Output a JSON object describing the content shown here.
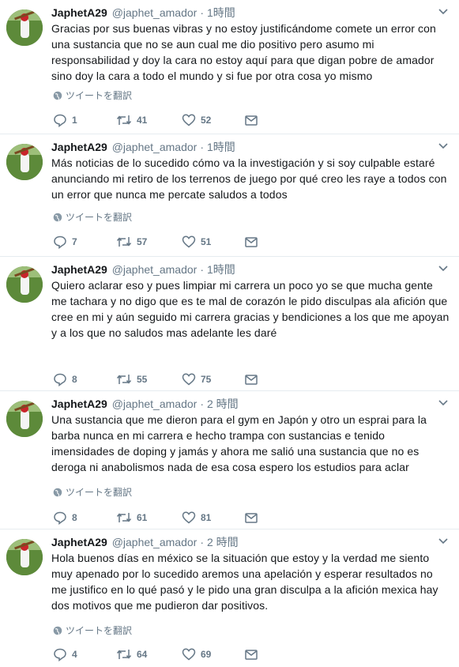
{
  "tweets": [
    {
      "name": "JaphetA29",
      "handle": "@japhet_amador",
      "dot": "·",
      "time": "1時間",
      "text": "Gracias por sus buenas vibras y no estoy justificándome comete un error con una sustancia que no se aun cual me dio positivo pero asumo mi responsabilidad y doy la cara no estoy aquí para que digan pobre de amador sino doy la cara a todo el mundo y si fue por otra cosa yo mismo",
      "translate": "ツイートを翻訳",
      "replies": "1",
      "retweets": "41",
      "likes": "52"
    },
    {
      "name": "JaphetA29",
      "handle": "@japhet_amador",
      "dot": "·",
      "time": "1時間",
      "text": "Más noticias de lo sucedido cómo va la investigación y si soy culpable estaré anunciando mi retiro de los terrenos de juego por qué creo les raye a todos con un error que nunca me percate saludos a todos",
      "translate": "ツイートを翻訳",
      "replies": "7",
      "retweets": "57",
      "likes": "51"
    },
    {
      "name": "JaphetA29",
      "handle": "@japhet_amador",
      "dot": "·",
      "time": "1時間",
      "text": "Quiero aclarar eso y pues limpiar mi carrera un poco yo se que mucha gente me tachara y no digo que es te mal de corazón le pido disculpas ala afición que cree en mi y aún seguido mi carrera gracias y bendiciones a los que me apoyan y a los que no saludos mas adelante les daré",
      "translate": "",
      "replies": "8",
      "retweets": "55",
      "likes": "75"
    },
    {
      "name": "JaphetA29",
      "handle": "@japhet_amador",
      "dot": "·",
      "time": "2 時間",
      "text": "Una sustancia que me dieron para el gym en Japón y otro un esprai para la barba nunca en mi carrera e hecho trampa con sustancias e tenido imensidades de doping y jamás y ahora me salió una sustancia que no es deroga ni anabolismos nada de esa cosa espero los estudios para aclar",
      "translate": "ツイートを翻訳",
      "replies": "8",
      "retweets": "61",
      "likes": "81"
    },
    {
      "name": "JaphetA29",
      "handle": "@japhet_amador",
      "dot": "·",
      "time": "2 時間",
      "text": "Hola buenos días en méxico se la situación que estoy y la verdad me siento muy apenado por lo sucedido aremos una apelación y esperar resultados no me justifico en lo qué pasó y le pido una gran disculpa a la afición mexica hay dos motivos que me pudieron dar positivos.",
      "translate": "ツイートを翻訳",
      "replies": "4",
      "retweets": "64",
      "likes": "69"
    }
  ]
}
